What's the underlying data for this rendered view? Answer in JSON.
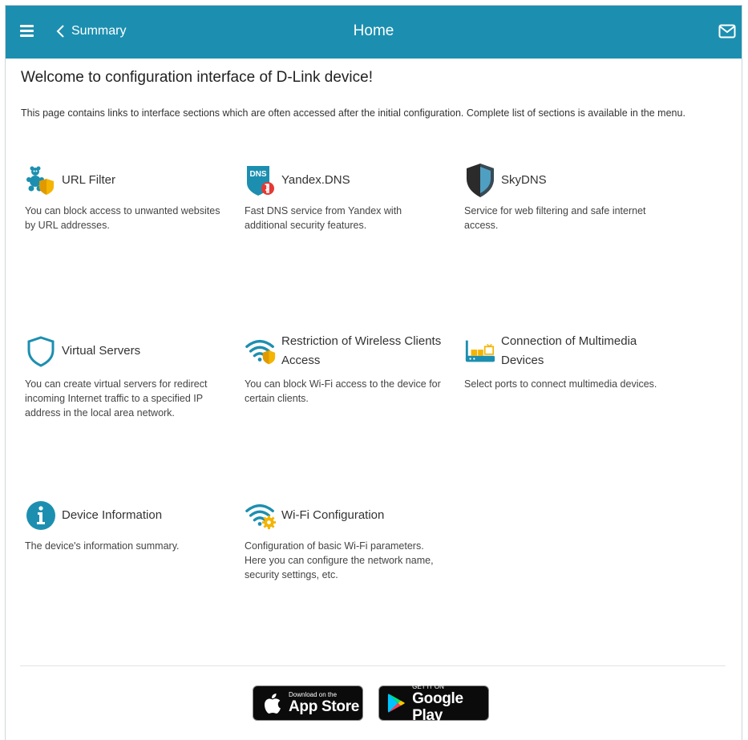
{
  "header": {
    "back_label": "Summary",
    "title": "Home",
    "bg_color": "#1c8fb0"
  },
  "main": {
    "welcome": "Welcome to configuration interface of D-Link device!",
    "intro": "This page contains links to interface sections which are often accessed after the initial configuration. Complete list of sections is available in the menu.",
    "cards": [
      {
        "icon": "url-filter-icon",
        "title": "URL Filter",
        "desc": "You can block access to unwanted websites by URL addresses."
      },
      {
        "icon": "yandex-dns-icon",
        "icon_text": "DNS",
        "title": "Yandex.DNS",
        "desc": "Fast DNS service from Yandex with additional security features."
      },
      {
        "icon": "skydns-shield-icon",
        "title": "SkyDNS",
        "desc": "Service for web filtering and safe internet access."
      },
      {
        "icon": "virtual-servers-shield-icon",
        "title": "Virtual Servers",
        "desc": "You can create virtual servers for redirect incoming Internet traffic to a specified IP address in the local area network."
      },
      {
        "icon": "wifi-shield-icon",
        "title": "Restriction of Wireless Clients Access",
        "desc": "You can block Wi-Fi access to the device for certain clients."
      },
      {
        "icon": "multimedia-devices-icon",
        "title": "Connection of Multimedia Devices",
        "desc": "Select ports to connect multimedia devices."
      },
      {
        "icon": "info-icon",
        "title": "Device Information",
        "desc": "The device's information summary."
      },
      {
        "icon": "wifi-gear-icon",
        "title": "Wi-Fi Configuration",
        "desc": "Configuration of basic Wi-Fi parameters. Here you can configure the network name, security settings, etc."
      }
    ]
  },
  "footer": {
    "app_store": {
      "small": "Download on the",
      "big": "App Store"
    },
    "google_play": {
      "small": "GET IT ON",
      "big": "Google Play"
    }
  }
}
